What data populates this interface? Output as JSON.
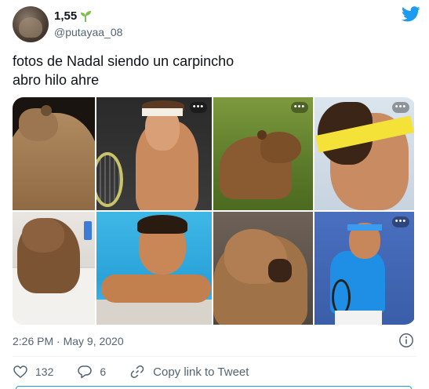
{
  "author": {
    "display_name": "1,55",
    "handle": "@putayaa_08",
    "badge_icon": "sprout-icon"
  },
  "platform_icon": "twitter-bird-icon",
  "brand_color": "#1d9bf0",
  "tweet": {
    "lines": [
      "fotos de Nadal siendo un carpincho",
      "abro hilo ahre"
    ]
  },
  "media": {
    "photos": [
      {
        "subject": "capybara",
        "more": "•••"
      },
      {
        "subject": "nadal",
        "more": "•••"
      },
      {
        "subject": "capybara",
        "more": "•••"
      },
      {
        "subject": "nadal",
        "more": "•••"
      },
      {
        "subject": "capybara",
        "more": "•••"
      },
      {
        "subject": "nadal",
        "more": "•••"
      },
      {
        "subject": "capybara",
        "more": "•••"
      },
      {
        "subject": "nadal",
        "more": "•••"
      }
    ]
  },
  "meta": {
    "timestamp": "2:26 PM · May 9, 2020",
    "info_icon": "info-icon"
  },
  "actions": {
    "likes": "132",
    "replies": "6",
    "copy_link": "Copy link to Tweet"
  }
}
